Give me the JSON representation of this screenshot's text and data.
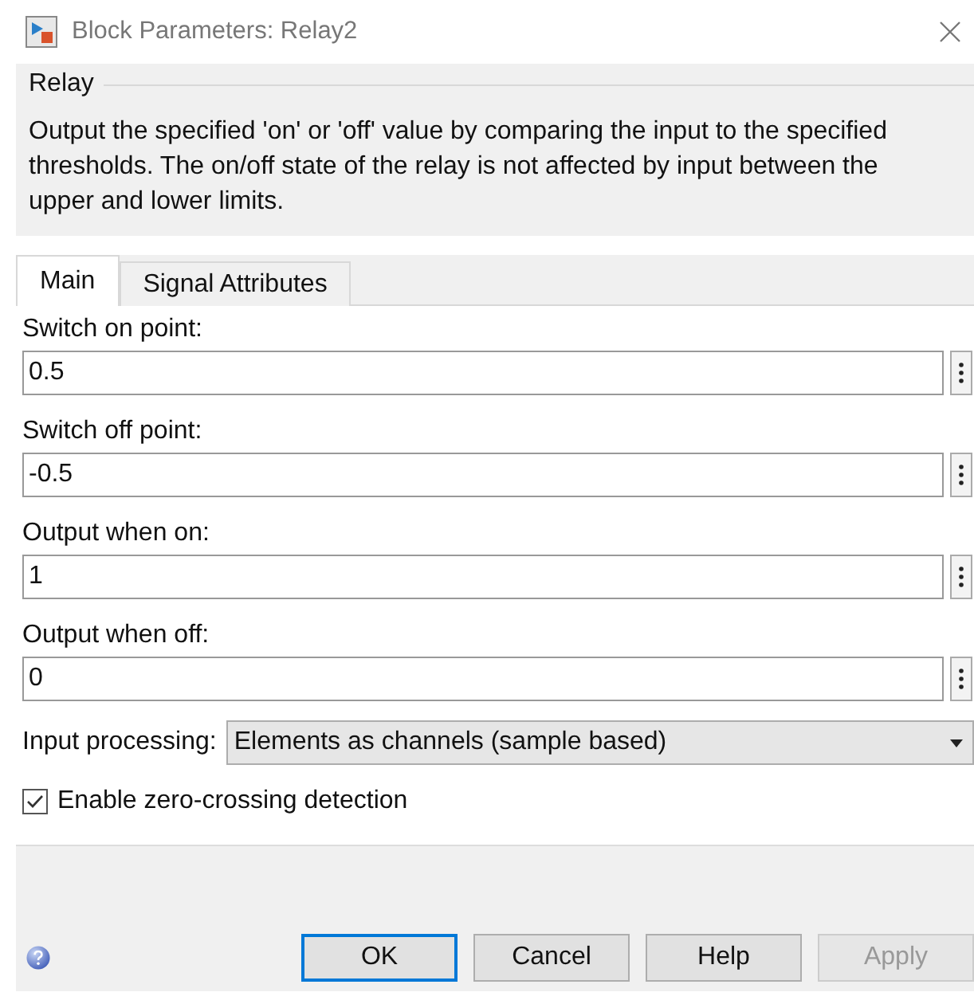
{
  "window": {
    "title": "Block Parameters: Relay2"
  },
  "group": {
    "title": "Relay",
    "description": "Output the specified 'on' or 'off' value by comparing the input to the specified thresholds.  The on/off state of the relay is not affected by input between the upper and lower limits."
  },
  "tabs": [
    {
      "label": "Main",
      "selected": true
    },
    {
      "label": "Signal Attributes",
      "selected": false
    }
  ],
  "fields": [
    {
      "label": "Switch on point:",
      "value": "0.5"
    },
    {
      "label": "Switch off point:",
      "value": "-0.5"
    },
    {
      "label": "Output when on:",
      "value": "1"
    },
    {
      "label": "Output when off:",
      "value": "0"
    }
  ],
  "input_processing": {
    "label": "Input processing:",
    "value": "Elements as channels (sample based)"
  },
  "zero_crossing": {
    "label": "Enable zero-crossing detection",
    "checked": true
  },
  "buttons": [
    {
      "label": "OK",
      "default": true,
      "disabled": false
    },
    {
      "label": "Cancel",
      "default": false,
      "disabled": false
    },
    {
      "label": "Help",
      "default": false,
      "disabled": false
    },
    {
      "label": "Apply",
      "default": false,
      "disabled": true
    }
  ]
}
